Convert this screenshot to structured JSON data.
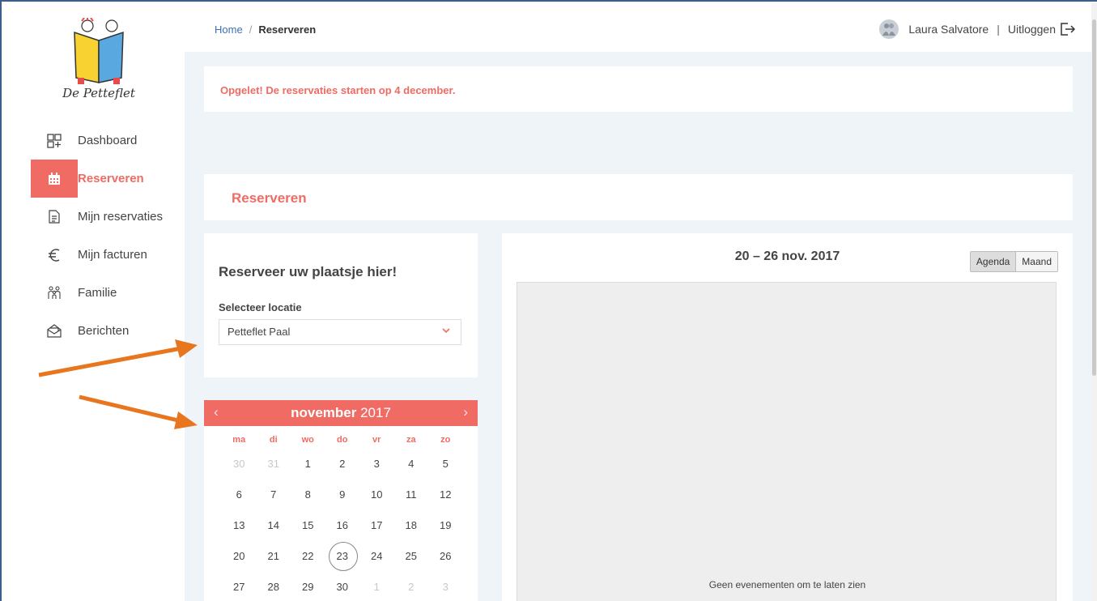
{
  "brand": {
    "name": "De Petteflet"
  },
  "sidebar": {
    "items": [
      {
        "label": "Dashboard",
        "icon": "dashboard-icon"
      },
      {
        "label": "Reserveren",
        "icon": "calendar-icon",
        "active": true
      },
      {
        "label": "Mijn reservaties",
        "icon": "document-icon"
      },
      {
        "label": "Mijn facturen",
        "icon": "euro-icon"
      },
      {
        "label": "Familie",
        "icon": "family-icon"
      },
      {
        "label": "Berichten",
        "icon": "envelope-icon"
      }
    ]
  },
  "breadcrumb": {
    "home": "Home",
    "separator": "/",
    "current": "Reserveren"
  },
  "user": {
    "name": "Laura Salvatore",
    "separator": "|",
    "logout": "Uitloggen"
  },
  "alert": {
    "text": "Opgelet! De reservaties starten op 4 december."
  },
  "section": {
    "title": "Reserveren"
  },
  "location": {
    "heading": "Reserveer uw plaatsje hier!",
    "label": "Selecteer locatie",
    "selected": "Petteflet Paal"
  },
  "calendar": {
    "month": "november",
    "year": "2017",
    "prev": "‹",
    "next": "›",
    "weekdays": [
      "ma",
      "di",
      "wo",
      "do",
      "vr",
      "za",
      "zo"
    ],
    "weeks": [
      [
        "30",
        "31",
        "1",
        "2",
        "3",
        "4",
        "5"
      ],
      [
        "6",
        "7",
        "8",
        "9",
        "10",
        "11",
        "12"
      ],
      [
        "13",
        "14",
        "15",
        "16",
        "17",
        "18",
        "19"
      ],
      [
        "20",
        "21",
        "22",
        "23",
        "24",
        "25",
        "26"
      ],
      [
        "27",
        "28",
        "29",
        "30",
        "1",
        "2",
        "3"
      ]
    ],
    "today": "23"
  },
  "agenda": {
    "range": "20 – 26 nov. 2017",
    "view_agenda": "Agenda",
    "view_month": "Maand",
    "empty": "Geen evenementen om te laten zien"
  },
  "colors": {
    "accent": "#f06b64",
    "annotation_arrow": "#e8761e",
    "link": "#3b6fb6"
  }
}
